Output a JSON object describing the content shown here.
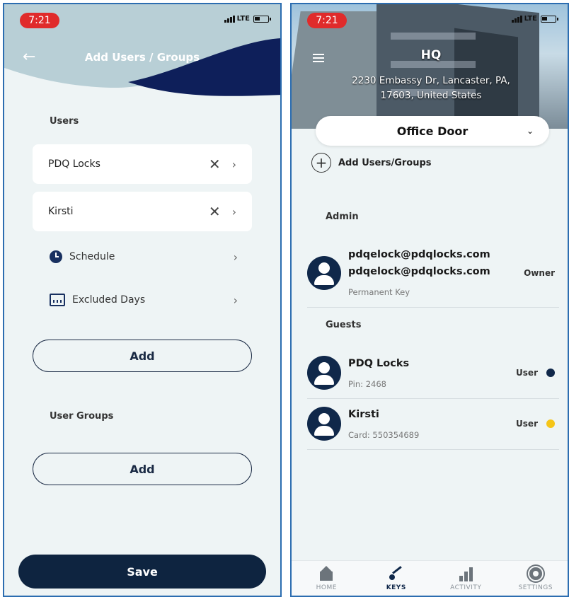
{
  "status": {
    "time": "7:21",
    "network": "LTE"
  },
  "left": {
    "title": "Add Users / Groups",
    "users_label": "Users",
    "users": [
      {
        "name": "PDQ Locks"
      },
      {
        "name": "Kirsti"
      }
    ],
    "options": {
      "schedule": "Schedule",
      "excluded_days": "Excluded Days"
    },
    "add_label": "Add",
    "user_groups_label": "User Groups",
    "add_groups_label": "Add",
    "save_label": "Save",
    "colors": {
      "header_light": "#b8cfd6",
      "header_dark": "#0e1f5a",
      "save_bg": "#0e2440"
    }
  },
  "right": {
    "location_title": "HQ",
    "address_line1": "2230 Embassy Dr, Lancaster, PA,",
    "address_line2": "17603, United States",
    "door": "Office Door",
    "add_users_groups": "Add Users/Groups",
    "admin_label": "Admin",
    "admin": {
      "name_line1": "pdqelock@pdqlocks.com",
      "name_line2": "pdqelock@pdqlocks.com",
      "sub": "Permanent Key",
      "role": "Owner"
    },
    "guests_label": "Guests",
    "guests": [
      {
        "name": "PDQ Locks",
        "sub": "Pin: 2468",
        "role": "User",
        "dot_color": "#10284a"
      },
      {
        "name": "Kirsti",
        "sub": "Card: 550354689",
        "role": "User",
        "dot_color": "#f5c518"
      }
    ],
    "tabs": [
      {
        "label": "HOME",
        "icon": "home-icon"
      },
      {
        "label": "KEYS",
        "icon": "key-icon"
      },
      {
        "label": "ACTIVITY",
        "icon": "activity-icon"
      },
      {
        "label": "SETTINGS",
        "icon": "gear-icon"
      }
    ],
    "active_tab": "KEYS"
  }
}
